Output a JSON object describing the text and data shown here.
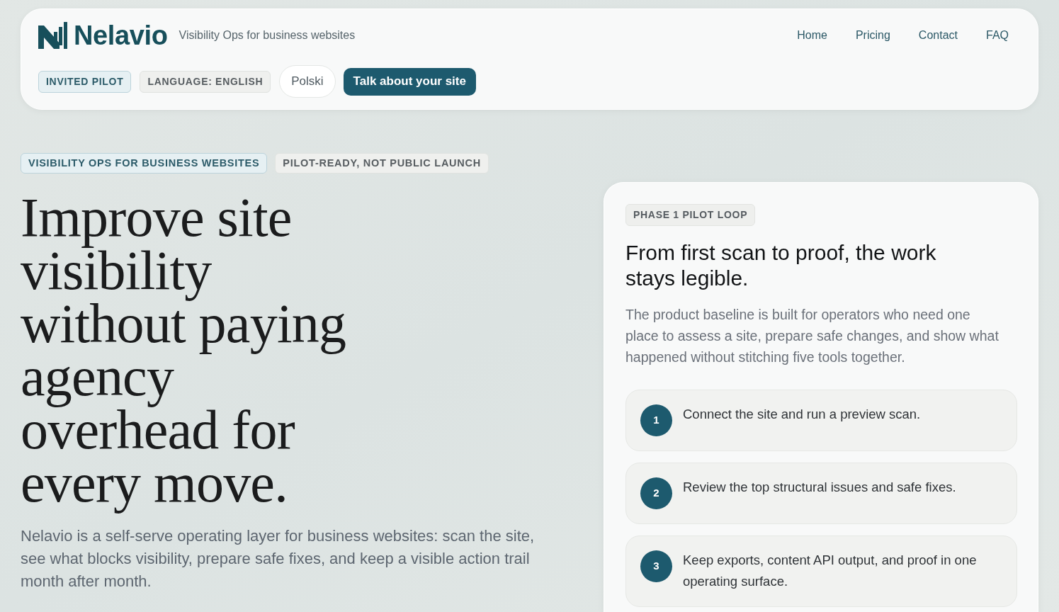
{
  "header": {
    "brand": "Nelavio",
    "tagline": "Visibility Ops for business websites",
    "nav": [
      {
        "label": "Home"
      },
      {
        "label": "Pricing"
      },
      {
        "label": "Contact"
      },
      {
        "label": "FAQ"
      }
    ],
    "badges": [
      {
        "label": "INVITED PILOT",
        "kind": "accent"
      },
      {
        "label": "LANGUAGE: ENGLISH",
        "kind": "neutral"
      }
    ],
    "language_button": "Polski",
    "cta_button": "Talk about your site"
  },
  "hero": {
    "badges": [
      {
        "label": "VISIBILITY OPS FOR BUSINESS WEBSITES",
        "kind": "accent"
      },
      {
        "label": "PILOT-READY, NOT PUBLIC LAUNCH",
        "kind": "neutral"
      }
    ],
    "headline": "Improve site visibility without paying agency overhead for every move.",
    "description": "Nelavio is a self-serve operating layer for business websites: scan the site, see what blocks visibility, prepare safe fixes, and keep a visible action trail month after month."
  },
  "pilot_card": {
    "badge": "PHASE 1 PILOT LOOP",
    "title": "From first scan to proof, the work stays legible.",
    "description": "The product baseline is built for operators who need one place to assess a site, prepare safe changes, and show what happened without stitching five tools together.",
    "steps": [
      {
        "number": "1",
        "text": "Connect the site and run a preview scan."
      },
      {
        "number": "2",
        "text": "Review the top structural issues and safe fixes."
      },
      {
        "number": "3",
        "text": "Keep exports, content API output, and proof in one operating surface."
      }
    ]
  }
}
